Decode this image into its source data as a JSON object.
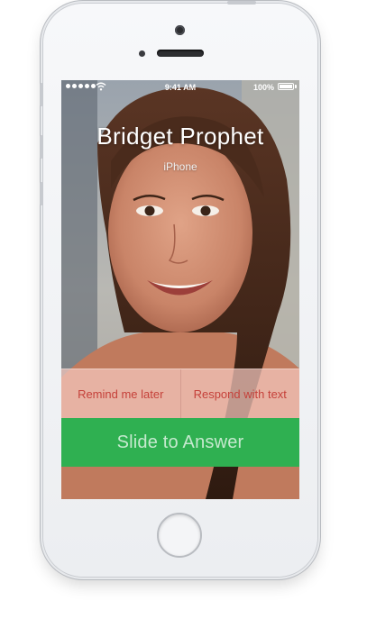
{
  "status_bar": {
    "time": "9:41 AM",
    "battery": "100%"
  },
  "call": {
    "caller_name": "Bridget Prophet",
    "caller_label": "iPhone"
  },
  "actions": {
    "remind": "Remind me later",
    "respond": "Respond with text"
  },
  "slider": {
    "label": "Slide to Answer"
  },
  "icons": [
    "signal-dots-icon",
    "wifi-icon",
    "battery-icon"
  ],
  "colors": {
    "answer_green": "#2fb051",
    "action_text_red": "#c5413a"
  }
}
